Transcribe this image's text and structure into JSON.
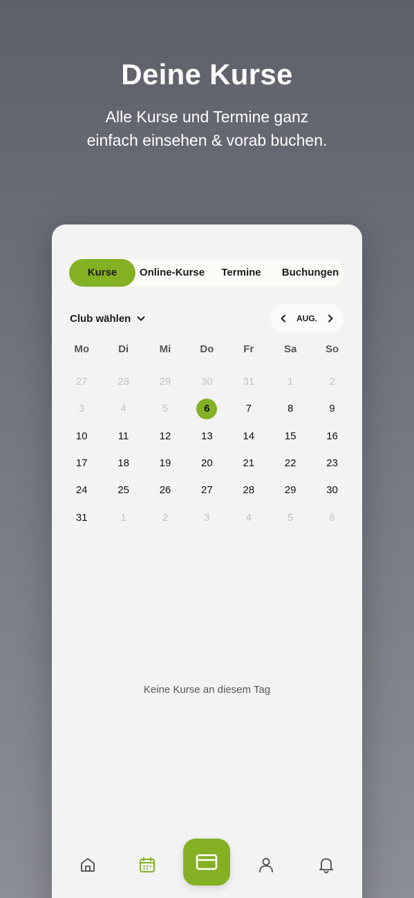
{
  "hero": {
    "title": "Deine Kurse",
    "subtitle": "Alle Kurse und Termine ganz einfach einsehen & vorab buchen."
  },
  "tabs": [
    {
      "label": "Kurse",
      "active": true
    },
    {
      "label": "Online-Kurse",
      "active": false
    },
    {
      "label": "Termine",
      "active": false
    },
    {
      "label": "Buchungen",
      "active": false
    }
  ],
  "club_select": {
    "label": "Club wählen",
    "icon": "chevron-down-icon"
  },
  "month_nav": {
    "label": "AUG.",
    "prev_icon": "chevron-left-icon",
    "next_icon": "chevron-right-icon"
  },
  "calendar": {
    "weekdays": [
      "Mo",
      "Di",
      "Mi",
      "Do",
      "Fr",
      "Sa",
      "So"
    ],
    "selected_day": "6",
    "days": [
      {
        "n": "27",
        "muted": true
      },
      {
        "n": "28",
        "muted": true
      },
      {
        "n": "29",
        "muted": true
      },
      {
        "n": "30",
        "muted": true
      },
      {
        "n": "31",
        "muted": true
      },
      {
        "n": "1",
        "muted": true
      },
      {
        "n": "2",
        "muted": true
      },
      {
        "n": "3",
        "muted": true
      },
      {
        "n": "4",
        "muted": true
      },
      {
        "n": "5",
        "muted": true
      },
      {
        "n": "6",
        "muted": false,
        "selected": true
      },
      {
        "n": "7",
        "muted": false
      },
      {
        "n": "8",
        "muted": false
      },
      {
        "n": "9",
        "muted": false
      },
      {
        "n": "10",
        "muted": false
      },
      {
        "n": "11",
        "muted": false
      },
      {
        "n": "12",
        "muted": false
      },
      {
        "n": "13",
        "muted": false
      },
      {
        "n": "14",
        "muted": false
      },
      {
        "n": "15",
        "muted": false
      },
      {
        "n": "16",
        "muted": false
      },
      {
        "n": "17",
        "muted": false
      },
      {
        "n": "18",
        "muted": false
      },
      {
        "n": "19",
        "muted": false
      },
      {
        "n": "20",
        "muted": false
      },
      {
        "n": "21",
        "muted": false
      },
      {
        "n": "22",
        "muted": false
      },
      {
        "n": "23",
        "muted": false
      },
      {
        "n": "24",
        "muted": false
      },
      {
        "n": "25",
        "muted": false
      },
      {
        "n": "26",
        "muted": false
      },
      {
        "n": "27",
        "muted": false
      },
      {
        "n": "28",
        "muted": false
      },
      {
        "n": "29",
        "muted": false
      },
      {
        "n": "30",
        "muted": false
      },
      {
        "n": "31",
        "muted": false
      },
      {
        "n": "1",
        "muted": true
      },
      {
        "n": "2",
        "muted": true
      },
      {
        "n": "3",
        "muted": true
      },
      {
        "n": "4",
        "muted": true
      },
      {
        "n": "5",
        "muted": true
      },
      {
        "n": "6",
        "muted": true
      }
    ]
  },
  "empty_message": "Keine Kurse an diesem Tag",
  "bottom_nav": [
    {
      "icon": "home-icon",
      "active": false
    },
    {
      "icon": "calendar-icon",
      "active": true
    },
    {
      "icon": "card-icon",
      "active": false,
      "center": true
    },
    {
      "icon": "user-icon",
      "active": false
    },
    {
      "icon": "bell-icon",
      "active": false
    }
  ],
  "colors": {
    "accent": "#84b024",
    "background_top": "#5d6069",
    "background_bottom": "#8c8e95",
    "panel": "#f3f3f3",
    "text": "#1a1a1a",
    "muted_text": "#c2c2c2",
    "icon": "#5a5a5a"
  }
}
